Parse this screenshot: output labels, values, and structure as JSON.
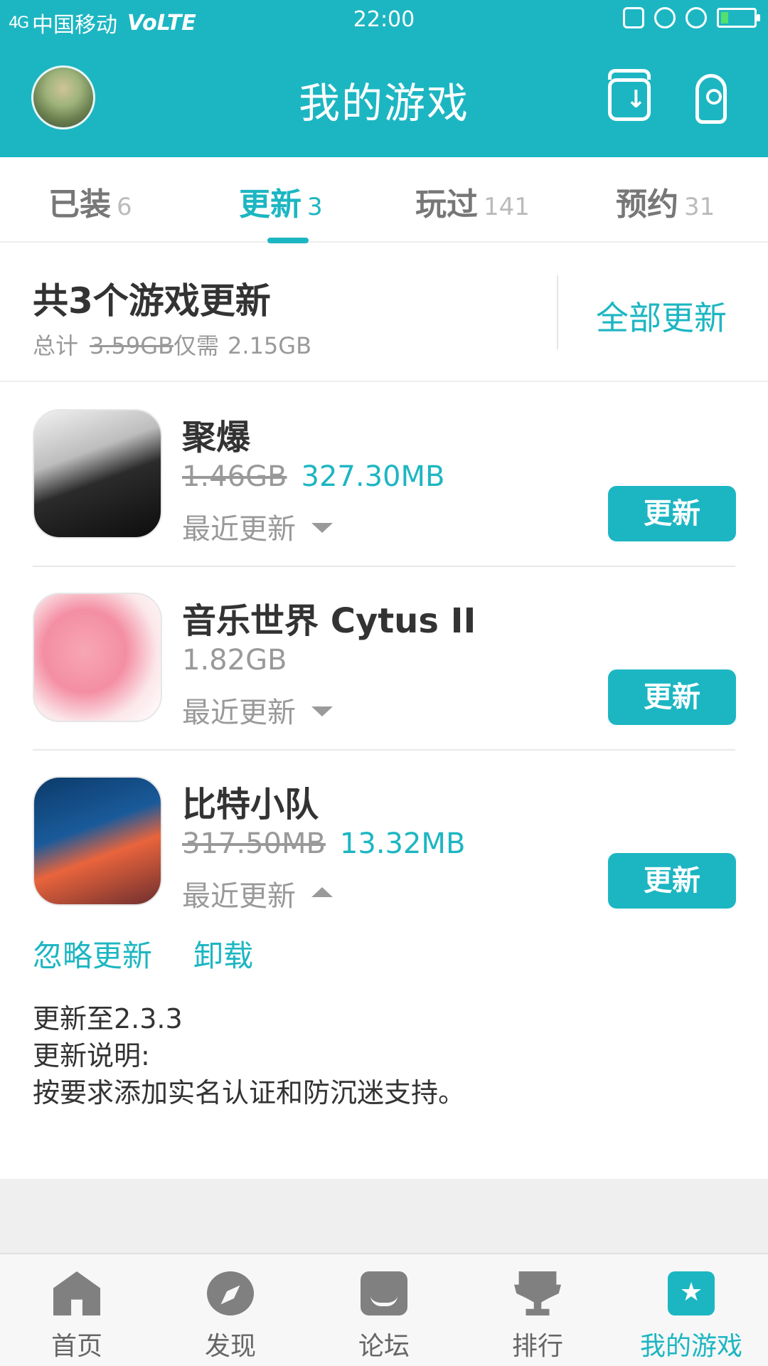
{
  "status_bar": {
    "carrier": "中国移动",
    "network": "VoLTE",
    "signal": "4G",
    "time": "22:00"
  },
  "header": {
    "title": "我的游戏",
    "colors": {
      "accent": "#1cb6c2"
    },
    "icons": [
      "avatar",
      "download-manager-icon",
      "rocket-icon"
    ]
  },
  "tabs": [
    {
      "label": "已装",
      "count": "6",
      "active": false
    },
    {
      "label": "更新",
      "count": "3",
      "active": true
    },
    {
      "label": "玩过",
      "count": "141",
      "active": false
    },
    {
      "label": "预约",
      "count": "31",
      "active": false
    }
  ],
  "summary": {
    "title": "共3个游戏更新",
    "prefix": "总计",
    "total_size": "3.59GB",
    "need_label": "仅需",
    "need_size": "2.15GB",
    "update_all": "全部更新"
  },
  "games": [
    {
      "name": "聚爆",
      "old_size": "1.46GB",
      "new_size": "327.30MB",
      "recent": "最近更新",
      "expanded": false,
      "button": "更新"
    },
    {
      "name": "音乐世界 Cytus II",
      "size": "1.82GB",
      "recent": "最近更新",
      "expanded": false,
      "button": "更新"
    },
    {
      "name": "比特小队",
      "old_size": "317.50MB",
      "new_size": "13.32MB",
      "recent": "最近更新",
      "expanded": true,
      "button": "更新"
    }
  ],
  "expanded_details": {
    "ignore": "忽略更新",
    "uninstall": "卸载",
    "version": "更新至2.3.3",
    "notes_label": "更新说明:",
    "notes": "按要求添加实名认证和防沉迷支持。"
  },
  "bottom_nav": [
    {
      "label": "首页",
      "icon": "home-icon"
    },
    {
      "label": "发现",
      "icon": "compass-icon"
    },
    {
      "label": "论坛",
      "icon": "forum-icon"
    },
    {
      "label": "排行",
      "icon": "trophy-icon"
    },
    {
      "label": "我的游戏",
      "icon": "my-games-icon",
      "active": true
    }
  ]
}
